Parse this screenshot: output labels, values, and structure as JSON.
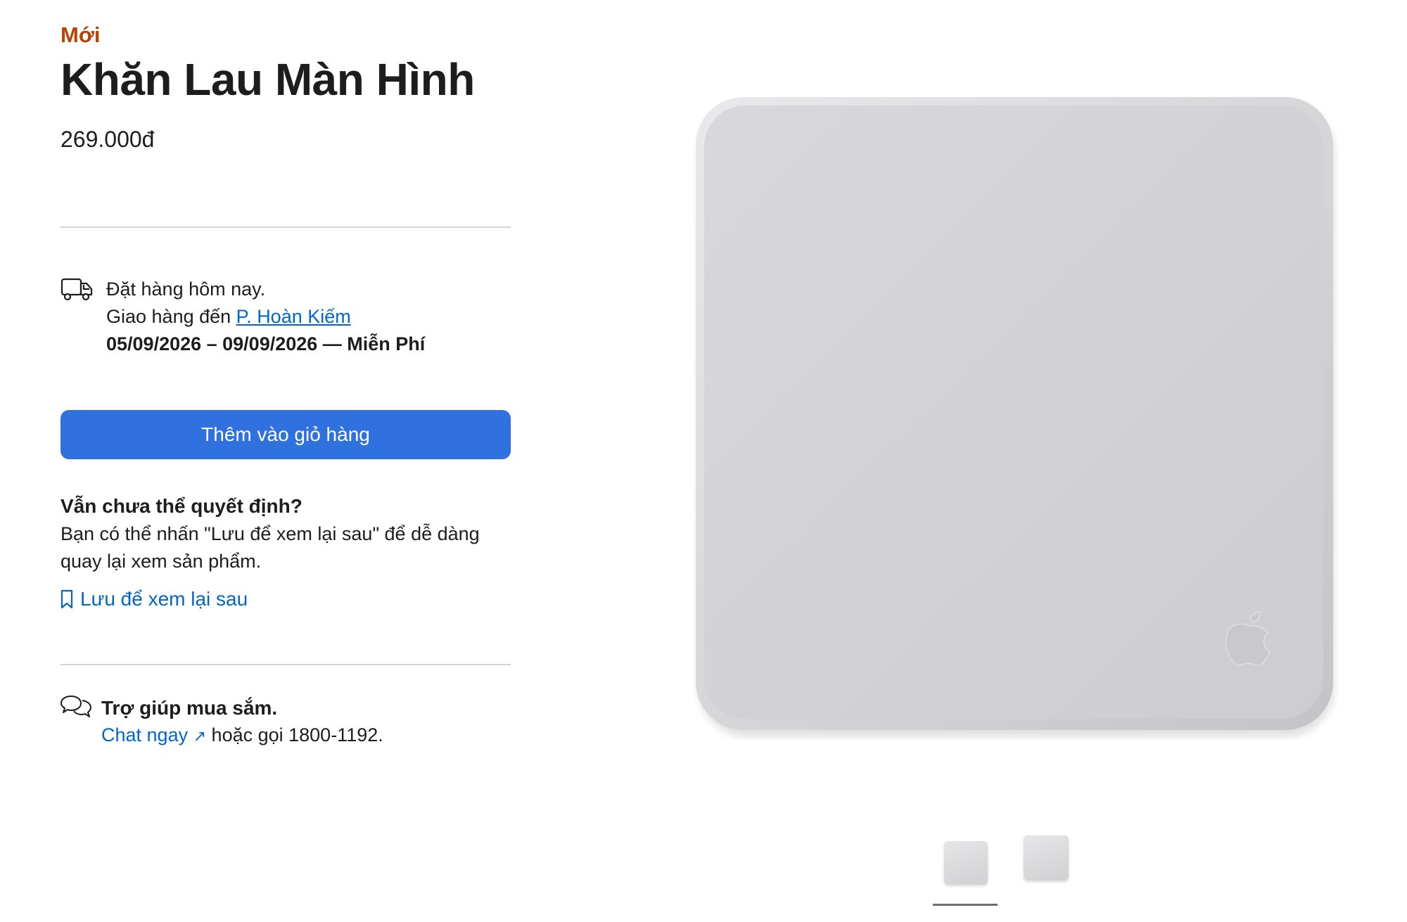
{
  "product": {
    "badge": "Mới",
    "title": "Khăn Lau Màn Hình",
    "price": "269.000đ"
  },
  "delivery": {
    "icon": "truck-icon",
    "line1": "Đặt hàng hôm nay.",
    "line2_prefix": "Giao hàng đến ",
    "location_link": "P. Hoàn Kiếm",
    "dates": "05/09/2026 – 09/09/2026 — Miễn Phí"
  },
  "cart_button": {
    "label": "Thêm vào giỏ hàng",
    "color": "#2f71df"
  },
  "undecided": {
    "title": "Vẫn chưa thể quyết định?",
    "text": "Bạn có thể nhấn \"Lưu để xem lại sau\" để dễ dàng quay lại xem sản phẩm.",
    "save_link": "Lưu để xem lại sau",
    "save_icon": "bookmark-icon"
  },
  "help": {
    "icon": "chat-bubbles-icon",
    "title": "Trợ giúp mua sắm.",
    "chat_link": "Chat ngay",
    "chat_arrow": "↗",
    "call_text": " hoặc gọi 1800-1192."
  },
  "gallery": {
    "main_image": "polishing-cloth-image",
    "thumbnails": [
      "thumbnail-cloth-front",
      "thumbnail-cloth-angle"
    ],
    "selected_index": 0
  },
  "colors": {
    "accent_badge": "#b64400",
    "link": "#0066cc"
  }
}
